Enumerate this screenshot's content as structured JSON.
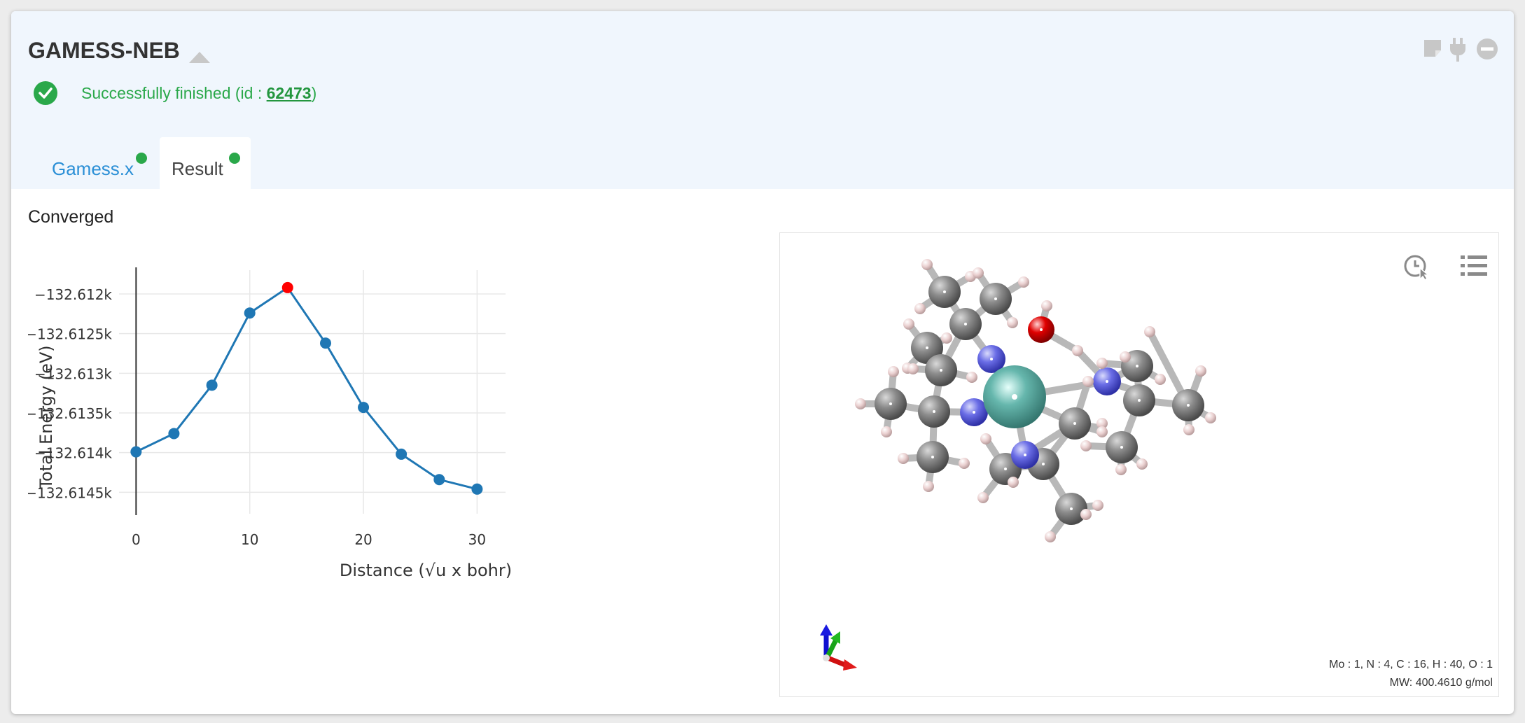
{
  "panel": {
    "title": "GAMESS-NEB",
    "status": {
      "prefix": "Successfully finished (id : ",
      "job_id": "62473",
      "suffix": ")",
      "color": "#2aa84a"
    },
    "header_icons": [
      "note-icon",
      "plug-icon",
      "minus-circle-icon"
    ]
  },
  "tabs": [
    {
      "label": "Gamess.x",
      "status_color": "#2aa84a",
      "active": false
    },
    {
      "label": "Result",
      "status_color": "#2aa84a",
      "active": true
    }
  ],
  "result": {
    "converged_label": "Converged"
  },
  "chart_data": {
    "type": "line",
    "xlabel": "Distance (√u x bohr)",
    "ylabel": "Total Energy (eV)",
    "xlim": [
      -1.5,
      32.5
    ],
    "ylim": [
      -132.6147,
      -132.6117
    ],
    "xticks": [
      0,
      10,
      20,
      30
    ],
    "xtick_labels": [
      "0",
      "10",
      "20",
      "30"
    ],
    "yticks": [
      -132.612,
      -132.6125,
      -132.613,
      -132.6135,
      -132.614,
      -132.6145
    ],
    "ytick_labels": [
      "−132.612k",
      "−132.6125k",
      "−132.613k",
      "−132.6135k",
      "−132.614k",
      "−132.6145k"
    ],
    "grid": true,
    "series": [
      {
        "x": [
          0,
          3.33,
          6.67,
          10,
          13.33,
          16.67,
          20,
          23.33,
          26.67,
          30
        ],
        "y": [
          -132.61399,
          -132.61376,
          -132.61315,
          -132.61224,
          -132.61192,
          -132.61262,
          -132.61343,
          -132.61402,
          -132.61434,
          -132.61446
        ],
        "color": "#1f77b4"
      }
    ],
    "highlight": {
      "index": 4,
      "color": "#ff0000"
    }
  },
  "viewer": {
    "formula": "Mo : 1, N : 4, C : 16, H : 40, O : 1",
    "mw": "MW: 400.4610 g/mol",
    "toolbar": [
      "pointer-clock-icon",
      "list-icon"
    ],
    "atom_colors": {
      "Mo": "#5fb8ad",
      "N": "#6a6de6",
      "C": "#8a8a8a",
      "H": "#f0d4d4",
      "O": "#e00000"
    }
  }
}
